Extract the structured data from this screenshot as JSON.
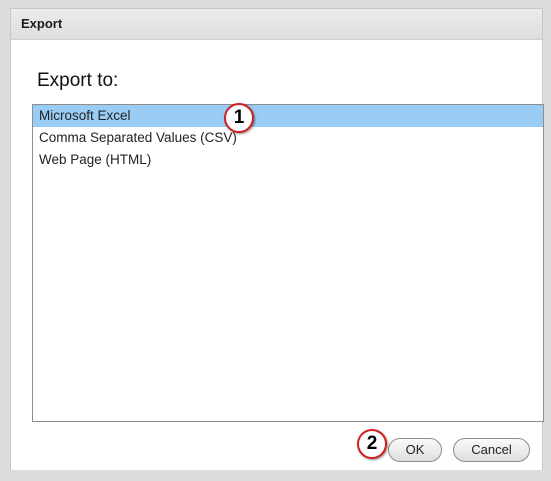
{
  "dialog": {
    "title": "Export",
    "heading": "Export to:",
    "options": [
      {
        "label": "Microsoft Excel",
        "selected": true
      },
      {
        "label": "Comma Separated Values (CSV)",
        "selected": false
      },
      {
        "label": "Web Page (HTML)",
        "selected": false
      }
    ],
    "ok_label": "OK",
    "cancel_label": "Cancel"
  },
  "annotations": {
    "step1": "1",
    "step2": "2"
  },
  "colors": {
    "selection": "#99cdf6",
    "badge_border": "#d02020"
  }
}
